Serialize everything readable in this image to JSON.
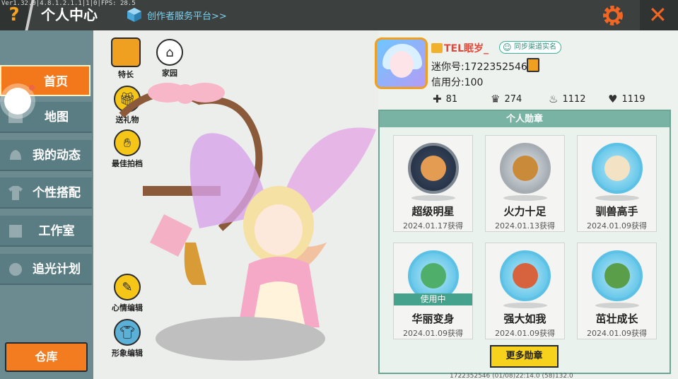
{
  "debug_text": "Ver1.32.0|4.8.1.2.1.1|1|0|FPS: 28.5",
  "header": {
    "help_label": "?",
    "title": "个人中心",
    "creator_link": "创作者服务平台>>",
    "close_label": "✕"
  },
  "sidebar": {
    "items": [
      {
        "label": "首页",
        "active": true
      },
      {
        "label": "地图"
      },
      {
        "label": "我的动态"
      },
      {
        "label": "个性搭配"
      },
      {
        "label": "工作室"
      },
      {
        "label": "追光计划"
      }
    ],
    "warehouse_label": "仓库"
  },
  "actions": {
    "specialty": "特长",
    "home": "家园",
    "gift": "送礼物",
    "best_partner": "最佳拍档",
    "mood_edit": "心情编辑",
    "image_edit": "形象编辑"
  },
  "profile": {
    "nickname": "TEL眠岁_",
    "verify_badge": "同步渠道实名",
    "uid": "迷你号:1722352546",
    "credit": "信用分:100",
    "stats": [
      "81",
      "274",
      "1112",
      "1119"
    ]
  },
  "medals": {
    "title": "个人勋章",
    "items": [
      {
        "name": "超级明星",
        "date": "2024.01.17获得"
      },
      {
        "name": "火力十足",
        "date": "2024.01.13获得"
      },
      {
        "name": "驯兽高手",
        "date": "2024.01.09获得"
      },
      {
        "name": "华丽变身",
        "date": "2024.01.09获得",
        "badge": "使用中"
      },
      {
        "name": "强大如我",
        "date": "2024.01.09获得"
      },
      {
        "name": "茁壮成长",
        "date": "2024.01.09获得"
      }
    ],
    "more_label": "更多勋章"
  },
  "footer_text": "1722352546 (01/08)22:14.0 (58)132.0",
  "colors": {
    "accent": "#f3781b",
    "topbar": "#3c4140",
    "panel": "#78b3a3"
  }
}
